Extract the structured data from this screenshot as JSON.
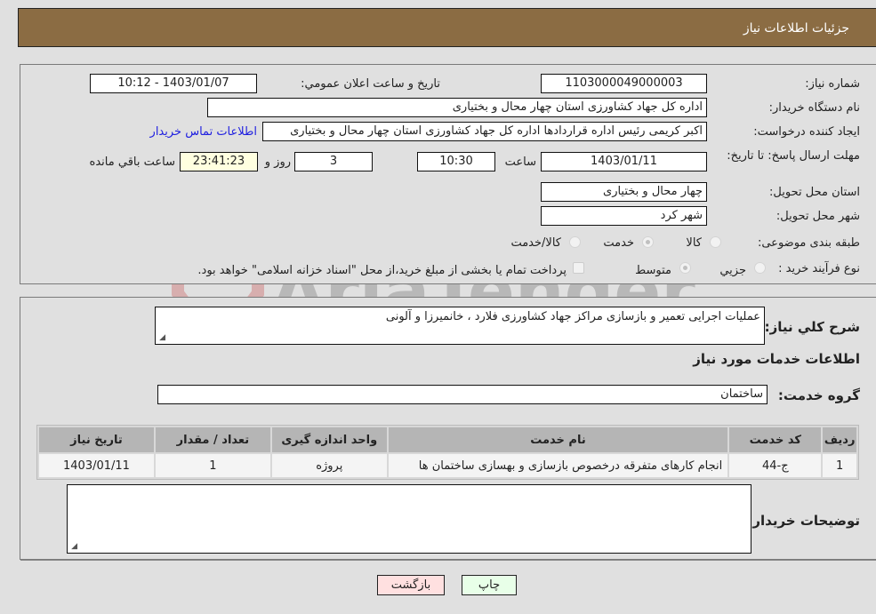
{
  "header": {
    "title": "جزئیات اطلاعات نیاز"
  },
  "form": {
    "need_number": {
      "label": "شماره نیاز:",
      "value": "1103000049000003"
    },
    "announce_datetime": {
      "label": "تاریخ و ساعت اعلان عمومي:",
      "value": "1403/01/07 - 10:12"
    },
    "buyer_org": {
      "label": "نام دستگاه خریدار:",
      "value": "اداره کل جهاد کشاورزی استان چهار محال و بختیاری"
    },
    "requester": {
      "label": "ایجاد کننده درخواست:",
      "value": "اکبر کریمی رئیس اداره قراردادها اداره کل جهاد کشاورزی استان چهار محال و بختیاری"
    },
    "buyer_contact_link": "اطلاعات تماس خریدار",
    "deadline": {
      "label": "مهلت ارسال پاسخ: تا تاریخ:",
      "date": "1403/01/11",
      "time_label": "ساعت",
      "time": "10:30",
      "days": "3",
      "days_label": "روز و",
      "remaining": "23:41:23",
      "remaining_label": "ساعت باقي مانده"
    },
    "province": {
      "label": "استان محل تحویل:",
      "value": "چهار محال و بختیاری"
    },
    "city": {
      "label": "شهر محل تحویل:",
      "value": "شهر کرد"
    },
    "category": {
      "label": "طبقه بندی موضوعی:",
      "options": [
        "کالا",
        "خدمت",
        "کالا/خدمت"
      ],
      "selected": "خدمت"
    },
    "purchase_type": {
      "label": "نوع فرآیند خرید :",
      "options": [
        "جزیي",
        "متوسط"
      ],
      "selected": "متوسط",
      "treasury_note": "پرداخت تمام یا بخشی از مبلغ خرید،از محل \"اسناد خزانه اسلامی\" خواهد بود."
    }
  },
  "details": {
    "summary_label": "شرح کلي نیاز:",
    "summary_value": "عملیات اجرایی تعمیر و بازسازی مراکز جهاد کشاورزی فلارد ، خانمیرزا و آلونی",
    "services_heading": "اطلاعات خدمات مورد نیاز",
    "service_group_label": "گروه خدمت:",
    "service_group_value": "ساختمان",
    "table": {
      "headers": [
        "ردیف",
        "کد خدمت",
        "نام خدمت",
        "واحد اندازه گیری",
        "تعداد / مقدار",
        "تاریخ نیاز"
      ],
      "rows": [
        [
          "1",
          "ج-44",
          "انجام کارهای متفرقه درخصوص بازسازی و بهسازی ساختمان ها",
          "پروژه",
          "1",
          "1403/01/11"
        ]
      ]
    },
    "buyer_notes_label": "توضیحات خریدار:",
    "buyer_notes_value": ""
  },
  "buttons": {
    "print": "چاپ",
    "back": "بازگشت"
  },
  "watermark": "AriaTender.net",
  "colors": {
    "header_bg": "#8b6c43",
    "print_bg": "#e8ffe8",
    "back_bg": "#ffe0e0",
    "link": "#2020e0"
  }
}
